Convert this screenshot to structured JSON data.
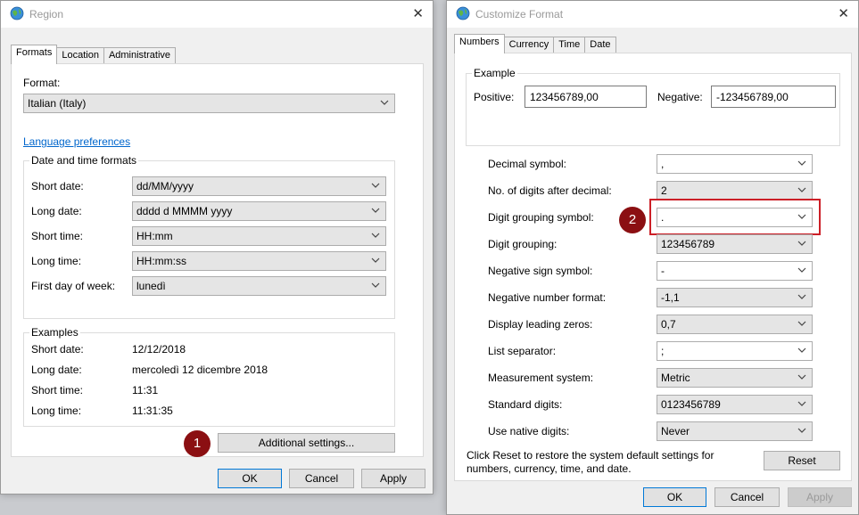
{
  "region": {
    "title": "Region",
    "tabs": [
      "Formats",
      "Location",
      "Administrative"
    ],
    "format_label": "Format:",
    "format_value": "Italian (Italy)",
    "language_link": "Language preferences",
    "datetime_group": "Date and time formats",
    "rows": [
      {
        "label": "Short date:",
        "value": "dd/MM/yyyy"
      },
      {
        "label": "Long date:",
        "value": "dddd d MMMM yyyy"
      },
      {
        "label": "Short time:",
        "value": "HH:mm"
      },
      {
        "label": "Long time:",
        "value": "HH:mm:ss"
      },
      {
        "label": "First day of week:",
        "value": "lunedì"
      }
    ],
    "examples_group": "Examples",
    "examples": [
      {
        "label": "Short date:",
        "value": "12/12/2018"
      },
      {
        "label": "Long date:",
        "value": "mercoledì 12 dicembre 2018"
      },
      {
        "label": "Short time:",
        "value": "11:31"
      },
      {
        "label": "Long time:",
        "value": "11:31:35"
      }
    ],
    "additional_button": "Additional settings...",
    "badge": "1",
    "ok": "OK",
    "cancel": "Cancel",
    "apply": "Apply"
  },
  "customize": {
    "title": "Customize Format",
    "tabs": [
      "Numbers",
      "Currency",
      "Time",
      "Date"
    ],
    "example_group": "Example",
    "positive_label": "Positive:",
    "positive_value": "123456789,00",
    "negative_label": "Negative:",
    "negative_value": "-123456789,00",
    "rows": [
      {
        "label": "Decimal symbol:",
        "value": ","
      },
      {
        "label": "No. of digits after decimal:",
        "value": "2"
      },
      {
        "label": "Digit grouping symbol:",
        "value": "."
      },
      {
        "label": "Digit grouping:",
        "value": "123456789"
      },
      {
        "label": "Negative sign symbol:",
        "value": "-"
      },
      {
        "label": "Negative number format:",
        "value": "-1,1"
      },
      {
        "label": "Display leading zeros:",
        "value": "0,7"
      },
      {
        "label": "List separator:",
        "value": ";"
      },
      {
        "label": "Measurement system:",
        "value": "Metric"
      },
      {
        "label": "Standard digits:",
        "value": "0123456789"
      },
      {
        "label": "Use native digits:",
        "value": "Never"
      }
    ],
    "reset_note_line1": "Click Reset to restore the system default settings for",
    "reset_note_line2": "numbers, currency, time, and date.",
    "reset": "Reset",
    "badge": "2",
    "ok": "OK",
    "cancel": "Cancel",
    "apply": "Apply"
  },
  "colors": {
    "badge": "#8b0f12",
    "highlight": "#cc1f27",
    "link": "#0066cc",
    "focus": "#0078d7"
  }
}
